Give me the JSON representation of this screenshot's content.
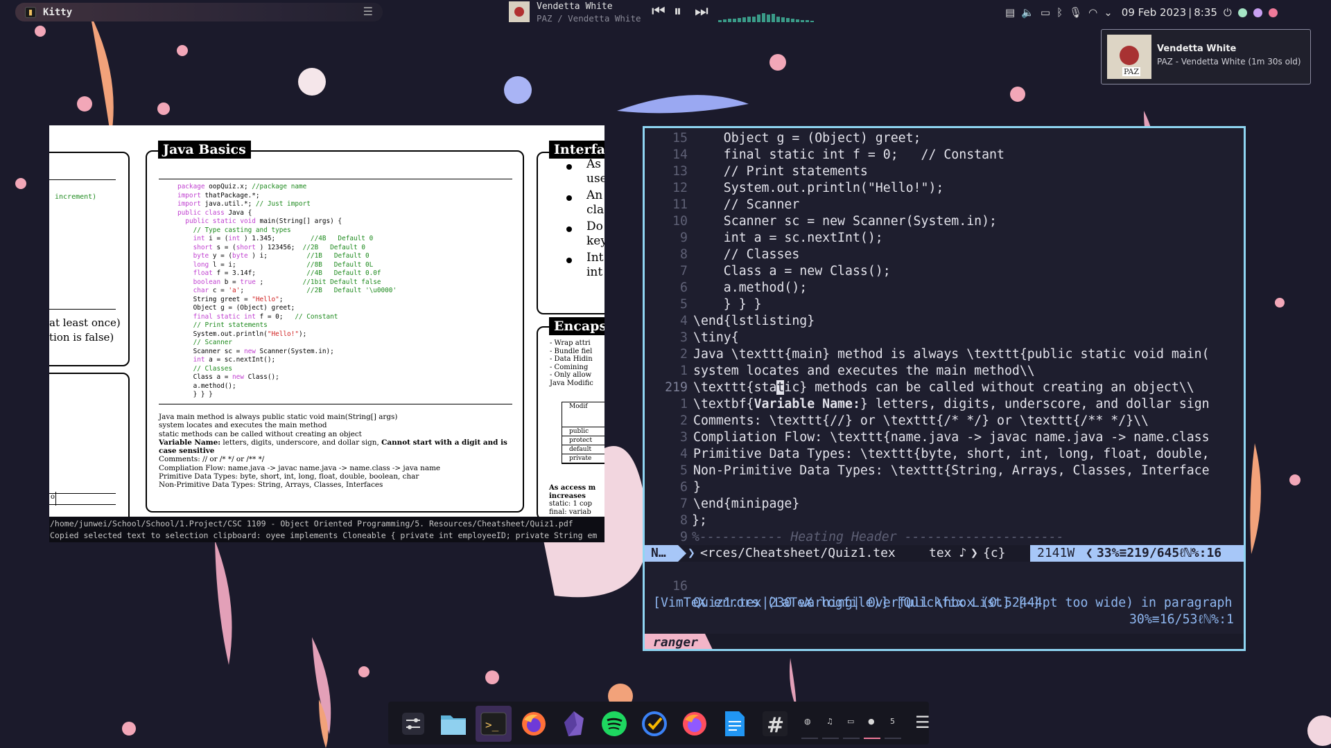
{
  "topbar": {
    "window_title": "Kitty",
    "media": {
      "track": "Vendetta White",
      "artist_album": "PAZ / Vendetta White",
      "prev_icon": "⏮",
      "play_pause_icon": "⏸",
      "next_icon": "⏭"
    },
    "tray": {
      "date": "09 Feb 2023",
      "time": "8:35"
    },
    "accent_colors": [
      "#a5e5c5",
      "#c9a0f2",
      "#f07a9a"
    ]
  },
  "notification": {
    "title": "Vendetta White",
    "body": "PAZ - Vendetta White (1m 30s old)",
    "art_text": "PAZ"
  },
  "pdf": {
    "box_java_basics_title": "Java Basics",
    "box_interface_title": "Interfa",
    "box_encaps_title": "Encaps",
    "left_fragment_1": "increment)",
    "left_fragment_2": "at least once)",
    "left_fragment_3": "tion is false)",
    "left_fragment_4": "o",
    "interface_bullets": [
      [
        "As",
        "use"
      ],
      [
        "An",
        "cla"
      ],
      [
        "Do",
        "key"
      ],
      [
        "Int",
        "int"
      ]
    ],
    "encaps_lines": [
      "- Wrap attri",
      "- Bundle fiel",
      "- Data Hidin",
      "- Comining",
      "- Only allow",
      "Java Modific"
    ],
    "encaps_table": [
      "Modif",
      "public",
      "protect",
      "default",
      "private"
    ],
    "encaps_footer": [
      "As access m",
      "increases",
      "static: 1 cop",
      "final: variab"
    ],
    "code_lines": [
      {
        "parts": [
          [
            "kw",
            "package"
          ],
          [
            "",
            "oopQuiz.x; "
          ],
          [
            "cm",
            "//package name"
          ]
        ]
      },
      {
        "parts": [
          [
            "kw",
            "import"
          ],
          [
            "",
            "thatPackage.*;"
          ]
        ]
      },
      {
        "parts": [
          [
            "kw",
            "import"
          ],
          [
            "",
            "java.util.*; "
          ],
          [
            "cm",
            "// Just import"
          ]
        ]
      },
      {
        "parts": [
          [
            "kw",
            "public class"
          ],
          [
            "",
            "Java {"
          ]
        ]
      },
      {
        "parts": [
          [
            "",
            "  "
          ],
          [
            "kw",
            "public static void"
          ],
          [
            "",
            "main(String[] args) {"
          ]
        ]
      },
      {
        "parts": [
          [
            "",
            "    "
          ],
          [
            "cm",
            "// Type casting and types"
          ]
        ]
      },
      {
        "parts": [
          [
            "",
            "    "
          ],
          [
            "kw",
            "int"
          ],
          [
            "",
            "i = ("
          ],
          [
            "kw",
            "int"
          ],
          [
            "",
            ") 1.345;         "
          ],
          [
            "cm",
            "//4B   Default 0"
          ]
        ]
      },
      {
        "parts": [
          [
            "",
            "    "
          ],
          [
            "kw",
            "short"
          ],
          [
            "",
            "s = ("
          ],
          [
            "kw",
            "short"
          ],
          [
            "",
            ") 123456;  "
          ],
          [
            "cm",
            "//2B   Default 0"
          ]
        ]
      },
      {
        "parts": [
          [
            "",
            "    "
          ],
          [
            "kw",
            "byte"
          ],
          [
            "",
            "y = ("
          ],
          [
            "kw",
            "byte"
          ],
          [
            "",
            ") i;          "
          ],
          [
            "cm",
            "//1B   Default 0"
          ]
        ]
      },
      {
        "parts": [
          [
            "",
            "    "
          ],
          [
            "kw",
            "long"
          ],
          [
            "",
            "l = i;                  "
          ],
          [
            "cm",
            "//8B   Default 0L"
          ]
        ]
      },
      {
        "parts": [
          [
            "",
            "    "
          ],
          [
            "kw",
            "float"
          ],
          [
            "",
            "f = 3.14f;             "
          ],
          [
            "cm",
            "//4B   Default 0.0f"
          ]
        ]
      },
      {
        "parts": [
          [
            "",
            "    "
          ],
          [
            "kw",
            "boolean"
          ],
          [
            "",
            "b = "
          ],
          [
            "kw",
            "true"
          ],
          [
            "",
            ";          "
          ],
          [
            "cm",
            "//1bit Default false"
          ]
        ]
      },
      {
        "parts": [
          [
            "",
            "    "
          ],
          [
            "kw",
            "char"
          ],
          [
            "",
            "c = "
          ],
          [
            "st",
            "'a'"
          ],
          [
            "",
            ";                "
          ],
          [
            "cm",
            "//2B   Default '\\u0000'"
          ]
        ]
      },
      {
        "parts": [
          [
            "",
            "    String greet = "
          ],
          [
            "st",
            "\"Hello\""
          ],
          [
            "",
            ";"
          ]
        ]
      },
      {
        "parts": [
          [
            "",
            "    Object g = (Object) greet;"
          ]
        ]
      },
      {
        "parts": [
          [
            "",
            "    "
          ],
          [
            "kw",
            "final static int"
          ],
          [
            "",
            "f = 0;   "
          ],
          [
            "cm",
            "// Constant"
          ]
        ]
      },
      {
        "parts": [
          [
            "",
            "    "
          ],
          [
            "cm",
            "// Print statements"
          ]
        ]
      },
      {
        "parts": [
          [
            "",
            "    System.out.println("
          ],
          [
            "st",
            "\"Hello!\""
          ],
          [
            "",
            ");"
          ]
        ]
      },
      {
        "parts": [
          [
            "",
            "    "
          ],
          [
            "cm",
            "// Scanner"
          ]
        ]
      },
      {
        "parts": [
          [
            "",
            "    Scanner sc = "
          ],
          [
            "kw",
            "new"
          ],
          [
            "",
            "Scanner(System.in);"
          ]
        ]
      },
      {
        "parts": [
          [
            "",
            "    "
          ],
          [
            "kw",
            "int"
          ],
          [
            "",
            "a = sc.nextInt();"
          ]
        ]
      },
      {
        "parts": [
          [
            "",
            "    "
          ],
          [
            "cm",
            "// Classes"
          ]
        ]
      },
      {
        "parts": [
          [
            "",
            "    Class a = "
          ],
          [
            "kw",
            "new"
          ],
          [
            "",
            "Class();"
          ]
        ]
      },
      {
        "parts": [
          [
            "",
            "    a.method();"
          ]
        ]
      },
      {
        "parts": [
          [
            "",
            "    } } }"
          ]
        ]
      }
    ],
    "para_1": "Java main method is always public static void main(String[] args)",
    "para_2": "system locates and executes the main method",
    "para_3": "static methods can be called without creating an object",
    "para_4_bold": "Variable Name:",
    "para_4_rest": " letters, digits, underscore, and dollar sign, ",
    "para_4_bold2": "Cannot start with a digit and is case sensitive",
    "para_5": "Comments: // or /* */ or /** */",
    "para_6": "Compliation Flow: name.java -> javac name.java -> name.class -> java name",
    "para_7": "Primitive Data Types: byte, short, int, long, float, double, boolean, char",
    "para_8": "Non-Primitive Data Types: String, Arrays, Classes, Interfaces",
    "status_path": "/home/junwei/School/School/1.Project/CSC 1109 - Object Oriented Programming/5. Resources/Cheatsheet/Quiz1.pdf",
    "status_msg": "Copied selected text to selection clipboard: oyee implements Cloneable { private int employeeID; private String em"
  },
  "vim": {
    "lines": [
      {
        "num": "15",
        "text": "    Object g = (Object) greet;"
      },
      {
        "num": "14",
        "text": "    final static int f = 0;   // Constant"
      },
      {
        "num": "13",
        "text": "    // Print statements"
      },
      {
        "num": "12",
        "text": "    System.out.println(\"Hello!\");"
      },
      {
        "num": "11",
        "text": "    // Scanner"
      },
      {
        "num": "10",
        "text": "    Scanner sc = new Scanner(System.in);"
      },
      {
        "num": "9",
        "text": "    int a = sc.nextInt();"
      },
      {
        "num": "8",
        "text": "    // Classes"
      },
      {
        "num": "7",
        "text": "    Class a = new Class();"
      },
      {
        "num": "6",
        "text": "    a.method();"
      },
      {
        "num": "5",
        "text": "    } } }"
      },
      {
        "num": "4",
        "text": "\\end{lstlisting}"
      },
      {
        "num": "3",
        "text": "\\tiny{"
      },
      {
        "num": "2",
        "text": "Java \\texttt{main} method is always \\texttt{public static void main("
      },
      {
        "num": "1",
        "text": "system locates and executes the main method\\\\"
      },
      {
        "num": "219",
        "text": "\\texttt{static} methods can be called without creating an object\\\\"
      },
      {
        "num": "1",
        "text": "\\textbf{Variable Name:} letters, digits, underscore, and dollar sign"
      },
      {
        "num": "2",
        "text": "Comments: \\texttt{//} or \\texttt{/* */} or \\texttt{/** */}\\\\"
      },
      {
        "num": "3",
        "text": "Compliation Flow: \\texttt{name.java -> javac name.java -> name.class"
      },
      {
        "num": "4",
        "text": "Primitive Data Types: \\texttt{byte, short, int, long, float, double,"
      },
      {
        "num": "5",
        "text": "Non-Primitive Data Types: \\texttt{String, Arrays, Classes, Interface"
      },
      {
        "num": "6",
        "text": "}"
      },
      {
        "num": "7",
        "text": "\\end{minipage}"
      },
      {
        "num": "8",
        "text": "};"
      },
      {
        "num": "9",
        "text": "%----------- Heating Header ---------------------"
      }
    ],
    "statusline": {
      "mode": "N…",
      "file": "<rces/Cheatsheet/Quiz1.tex",
      "filetype": "tex ♪",
      "scope": "{c}",
      "words": "2141W",
      "position": "33%≡219/645ℓℕ%:16"
    },
    "quickfix_line_num": "16",
    "quickfix_line": "Quiz1.tex|230 warning| Overfull \\hbox (0.52444pt too wide) in paragraph",
    "qf_status_left": "[VimTeX errors (LaTeX logfile)] [Quickfix List] [-]",
    "qf_status_right": "30%≡16/53ℓℕ%:1",
    "tab_name": "ranger"
  },
  "dock": {
    "apps": [
      "settings-icon",
      "files-icon",
      "terminal-icon",
      "firefox-icon",
      "obsidian-icon",
      "spotify-icon",
      "todo-icon",
      "firefox-dev-icon",
      "docs-icon",
      "slack-hash-icon"
    ],
    "workspaces": [
      "",
      "♫",
      "",
      "",
      "5"
    ],
    "menu_icon": "menu-lines-icon"
  }
}
